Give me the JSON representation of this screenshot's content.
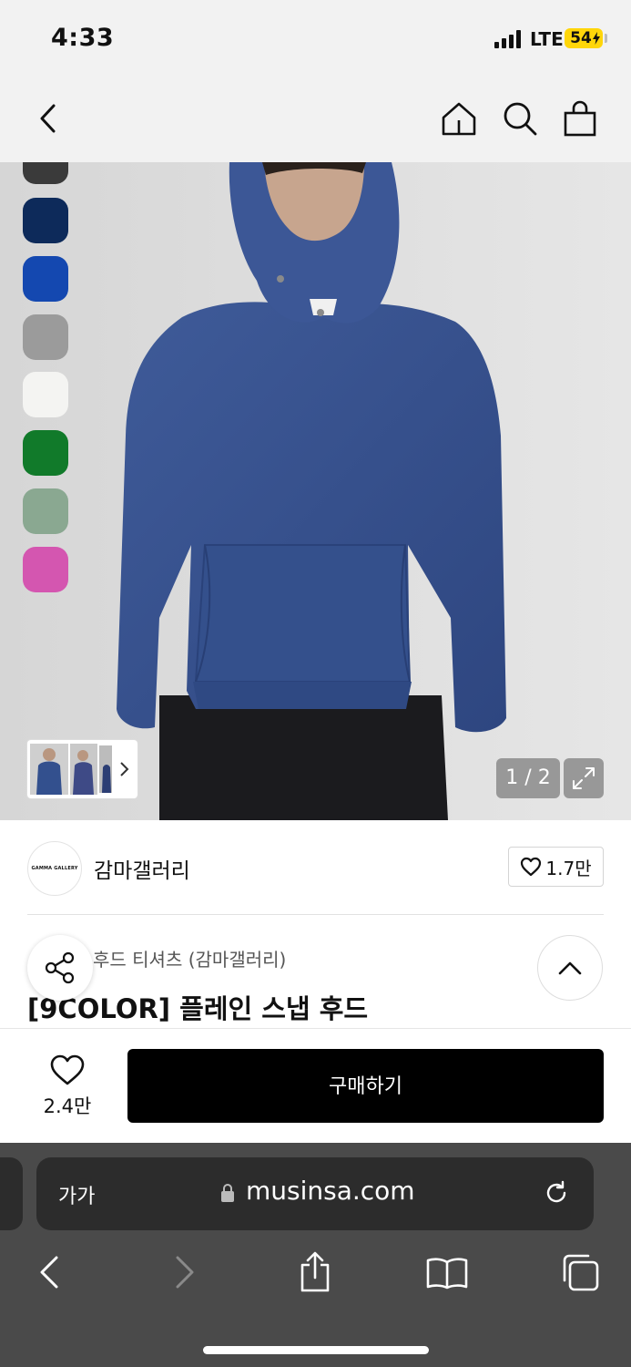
{
  "status_bar": {
    "time": "4:33",
    "network": "LTE",
    "battery": "54"
  },
  "nav": {
    "back": "back-chevron-icon",
    "icons": [
      "home-icon",
      "search-icon",
      "shopping-bag-icon"
    ]
  },
  "gallery": {
    "swatches": [
      "#3a3a3a",
      "#0d2a5a",
      "#1448b0",
      "#9b9b9b",
      "#f4f4f2",
      "#117a2a",
      "#8aa891",
      "#d456b0"
    ],
    "page_counter": "1 / 2"
  },
  "brand": {
    "logo_text": "GAMMA GALLERY",
    "name": "감마갤러리",
    "like_count": "1.7만"
  },
  "product": {
    "category": "후드 티셔츠 (감마갤러리)",
    "title": "[9COLOR] 플레인 스냅 후드"
  },
  "purchase": {
    "wish_count": "2.4만",
    "buy_label": "구매하기"
  },
  "safari": {
    "text_size_label": "가가",
    "url": "musinsa.com"
  }
}
